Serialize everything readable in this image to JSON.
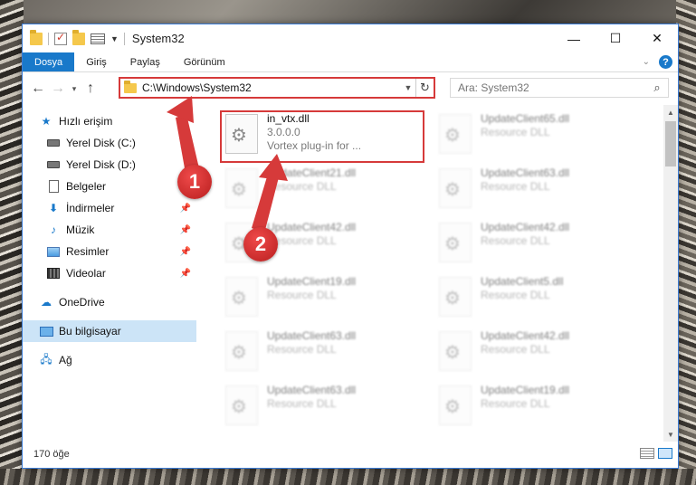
{
  "window": {
    "title": "System32",
    "controls": {
      "minimize": "—",
      "maximize": "☐",
      "close": "✕"
    }
  },
  "ribbon": {
    "tabs": [
      {
        "label": "Dosya",
        "active": true
      },
      {
        "label": "Giriş"
      },
      {
        "label": "Paylaş"
      },
      {
        "label": "Görünüm"
      }
    ],
    "help": "?"
  },
  "nav": {
    "back": "←",
    "forward": "→",
    "recent": "▾",
    "up": "↑",
    "address": "C:\\Windows\\System32",
    "refresh": "↻",
    "search_placeholder": "Ara: System32"
  },
  "sidebar": {
    "items": [
      {
        "label": "Hızlı erişim",
        "icon": "star-icon"
      },
      {
        "label": "Yerel Disk (C:)",
        "icon": "drive-icon",
        "pinned": true
      },
      {
        "label": "Yerel Disk (D:)",
        "icon": "drive-icon"
      },
      {
        "label": "Belgeler",
        "icon": "documents-icon"
      },
      {
        "label": "İndirmeler",
        "icon": "download-icon",
        "pinned": true
      },
      {
        "label": "Müzik",
        "icon": "music-icon",
        "pinned": true
      },
      {
        "label": "Resimler",
        "icon": "pictures-icon",
        "pinned": true
      },
      {
        "label": "Videolar",
        "icon": "videos-icon",
        "pinned": true
      },
      {
        "label": "OneDrive",
        "icon": "cloud-icon"
      },
      {
        "label": "Bu bilgisayar",
        "icon": "computer-icon",
        "selected": true
      },
      {
        "label": "Ağ",
        "icon": "network-icon"
      }
    ]
  },
  "files": [
    {
      "name": "in_vtx.dll",
      "line2": "3.0.0.0",
      "line3": "Vortex plug-in for ...",
      "highlighted": true
    },
    {
      "name": "UpdateClient65.dll",
      "line2": "Resource DLL"
    },
    {
      "name": "UpdateClient21.dll",
      "line2": "Resource DLL"
    },
    {
      "name": "UpdateClient63.dll",
      "line2": "Resource DLL"
    },
    {
      "name": "UpdateClient42.dll",
      "line2": "Resource DLL"
    },
    {
      "name": "UpdateClient42.dll",
      "line2": "Resource DLL"
    },
    {
      "name": "UpdateClient19.dll",
      "line2": "Resource DLL"
    },
    {
      "name": "UpdateClient5.dll",
      "line2": "Resource DLL"
    },
    {
      "name": "UpdateClient63.dll",
      "line2": "Resource DLL"
    },
    {
      "name": "UpdateClient42.dll",
      "line2": "Resource DLL"
    },
    {
      "name": "UpdateClient63.dll",
      "line2": "Resource DLL"
    },
    {
      "name": "UpdateClient19.dll",
      "line2": "Resource DLL"
    }
  ],
  "status": {
    "count": "170 öğe"
  },
  "annotations": {
    "step1": "1",
    "step2": "2",
    "color": "#d63a3a"
  }
}
